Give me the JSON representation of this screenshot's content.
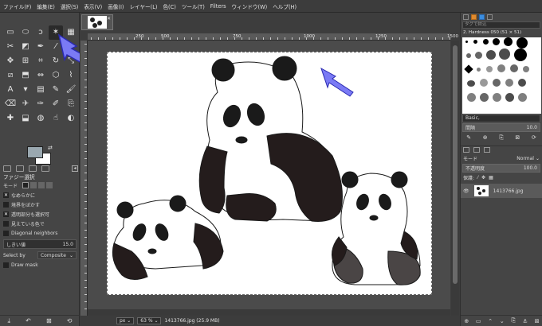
{
  "menu": [
    "ファイル(F)",
    "編集(E)",
    "選択(S)",
    "表示(V)",
    "画像(I)",
    "レイヤー(L)",
    "色(C)",
    "ツール(T)",
    "Filters",
    "ウィンドウ(W)",
    "ヘルプ(H)"
  ],
  "tools": [
    {
      "name": "rect-select",
      "glyph": "▭"
    },
    {
      "name": "ellipse-select",
      "glyph": "⬭"
    },
    {
      "name": "free-select",
      "glyph": "ↄ"
    },
    {
      "name": "fuzzy-select",
      "glyph": "✶"
    },
    {
      "name": "select-by-color",
      "glyph": "▦"
    },
    {
      "name": "scissors-select",
      "glyph": "✂"
    },
    {
      "name": "foreground-select",
      "glyph": "◩"
    },
    {
      "name": "paths",
      "glyph": "✒"
    },
    {
      "name": "color-picker",
      "glyph": "⁄"
    },
    {
      "name": "zoom",
      "glyph": "⚲"
    },
    {
      "name": "move",
      "glyph": "✥"
    },
    {
      "name": "align",
      "glyph": "⊞"
    },
    {
      "name": "crop",
      "glyph": "⌗"
    },
    {
      "name": "rotate",
      "glyph": "↻"
    },
    {
      "name": "scale",
      "glyph": "⤡"
    },
    {
      "name": "shear",
      "glyph": "⧄"
    },
    {
      "name": "perspective",
      "glyph": "⬒"
    },
    {
      "name": "flip",
      "glyph": "⇔"
    },
    {
      "name": "cage",
      "glyph": "⬡"
    },
    {
      "name": "warp",
      "glyph": "⌇"
    },
    {
      "name": "text",
      "glyph": "A"
    },
    {
      "name": "bucket-fill",
      "glyph": "▾"
    },
    {
      "name": "gradient",
      "glyph": "▤"
    },
    {
      "name": "pencil",
      "glyph": "✎"
    },
    {
      "name": "paintbrush",
      "glyph": "🖌"
    },
    {
      "name": "eraser",
      "glyph": "⌫"
    },
    {
      "name": "airbrush",
      "glyph": "✈"
    },
    {
      "name": "ink",
      "glyph": "✑"
    },
    {
      "name": "mypaint",
      "glyph": "✐"
    },
    {
      "name": "clone",
      "glyph": "⎘"
    },
    {
      "name": "heal",
      "glyph": "✚"
    },
    {
      "name": "perspective-clone",
      "glyph": "⬓"
    },
    {
      "name": "blur",
      "glyph": "◍"
    },
    {
      "name": "smudge",
      "glyph": "☝"
    },
    {
      "name": "dodge-burn",
      "glyph": "◐"
    }
  ],
  "tool_options": {
    "title": "ファジー選択",
    "mode_label": "モード",
    "antialias": "なめらかに",
    "feather": "境界をぼかす",
    "transparent": "透明部分も選択可",
    "sample_merged": "見えている色で",
    "diagonal": "Diagonal neighbors",
    "threshold_label": "しきい値",
    "threshold_value": "15.0",
    "select_by_label": "Select by",
    "select_by_value": "Composite",
    "draw_mask": "Draw mask"
  },
  "ruler": {
    "top_labels": [
      "0",
      "250",
      "500",
      "750",
      "1000",
      "1250",
      "1500"
    ]
  },
  "status": {
    "unit": "px",
    "zoom": "63 %",
    "file": "1413766.jpg (25.9 MB)"
  },
  "brushes": {
    "filter_placeholder": "タグで絞込",
    "current": "2. Hardness 050 (51 × 51)",
    "preset": "Basic,",
    "spacing_label": "間隔",
    "spacing_value": "10.0"
  },
  "layers": {
    "mode_label": "モード",
    "mode_value": "Normal",
    "opacity_label": "不透明度",
    "opacity_value": "100.0",
    "lock_label": "保護:",
    "layer_name": "1413766.jpg"
  },
  "colors": {
    "foreground": "#9aa8b0",
    "background": "#ffffff",
    "accent_arrow": "#6a6af0"
  }
}
